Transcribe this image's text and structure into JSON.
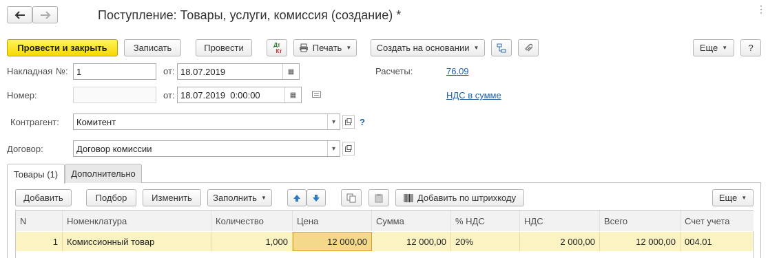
{
  "window": {
    "title": "Поступление: Товары, услуги, комиссия (создание) *"
  },
  "toolbar": {
    "post_close_label": "Провести и закрыть",
    "save_label": "Записать",
    "post_label": "Провести",
    "dtkt_top": "Дт",
    "dtkt_bottom": "Кт",
    "print_label": "Печать",
    "create_based_label": "Создать на основании",
    "more_label": "Еще",
    "help_label": "?"
  },
  "form": {
    "invoice_label": "Накладная",
    "no_label": "№:",
    "invoice_number": "1",
    "from_label": "от:",
    "invoice_date": "18.07.2019",
    "number_label": "Номер:",
    "number_value": "",
    "from2_label": "от:",
    "number_date": "18.07.2019  0:00:00",
    "settlements_label": "Расчеты:",
    "settlements_link": "76.09",
    "vat_link": "НДС в сумме",
    "counterparty_label": "Контрагент:",
    "counterparty_value": "Комитент",
    "help_q": "?",
    "contract_label": "Договор:",
    "contract_value": "Договор комиссии"
  },
  "tabs": [
    {
      "label": "Товары (1)",
      "active": true
    },
    {
      "label": "Дополнительно",
      "active": false
    }
  ],
  "table_toolbar": {
    "add_label": "Добавить",
    "select_label": "Подбор",
    "change_label": "Изменить",
    "fill_label": "Заполнить",
    "barcode_label": "Добавить по штрихкоду",
    "more_label": "Еще"
  },
  "table": {
    "columns": [
      "N",
      "Номенклатура",
      "Количество",
      "Цена",
      "Сумма",
      "% НДС",
      "НДС",
      "Всего",
      "Счет учета"
    ],
    "rows": [
      [
        "1",
        "Комиссионный товар",
        "1,000",
        "12 000,00",
        "12 000,00",
        "20%",
        "2 000,00",
        "12 000,00",
        "004.01"
      ]
    ]
  },
  "colors": {
    "primary_button": "#f6d900",
    "link": "#1f5fa8",
    "selected_row": "#fbf3c2",
    "active_cell": "#f5d98a"
  },
  "icons": [
    "back-arrow-icon",
    "forward-arrow-icon",
    "dt-kt-icon",
    "printer-icon",
    "structure-icon",
    "paperclip-icon",
    "calendar-icon",
    "open-icon",
    "comment-icon",
    "arrow-up-icon",
    "arrow-down-icon",
    "copy-icon",
    "paste-icon",
    "barcode-icon"
  ]
}
